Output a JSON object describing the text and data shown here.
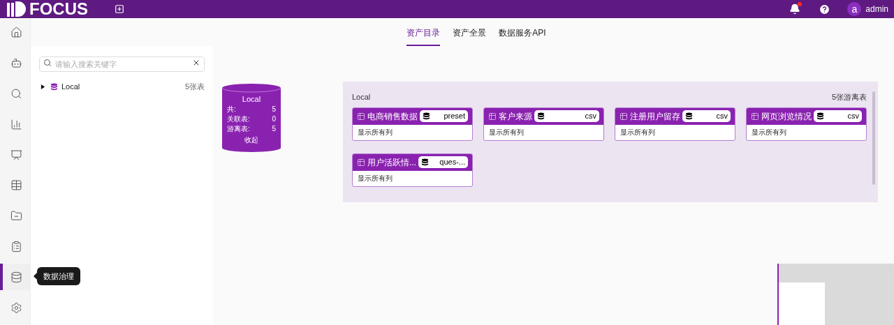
{
  "topbar": {
    "logo": "FOCUS",
    "avatar": "a",
    "user": "admin",
    "notification": true
  },
  "sidebar": {
    "items": [
      {
        "selected": false
      },
      {
        "selected": false
      },
      {
        "selected": false
      },
      {
        "selected": false
      },
      {
        "selected": false
      },
      {
        "selected": false
      },
      {
        "selected": false
      },
      {
        "selected": false
      },
      {
        "selected": true
      },
      {
        "selected": false
      }
    ],
    "tooltip": "数据治理"
  },
  "tabs": [
    {
      "label": "资产目录",
      "selected": true
    },
    {
      "label": "资产全景",
      "selected": false
    },
    {
      "label": "数据服务API",
      "selected": false
    }
  ],
  "search": {
    "placeholder": "请输入搜索关键字"
  },
  "tree": [
    {
      "label": "Local",
      "count": "5张表",
      "expanded": false
    }
  ],
  "source": {
    "title": "Local",
    "stats": [
      {
        "label": "共:",
        "value": "5"
      },
      {
        "label": "关联表:",
        "value": "0"
      },
      {
        "label": "游离表:",
        "value": "5"
      }
    ],
    "toggle": "收起"
  },
  "panel": {
    "title": "Local",
    "count": "5张游离表",
    "tables": [
      {
        "name": "电商销售数据",
        "source": "preset",
        "detail": "显示所有列"
      },
      {
        "name": "客户来源",
        "source": "csv",
        "detail": "显示所有列"
      },
      {
        "name": "注册用户留存",
        "source": "csv",
        "detail": "显示所有列"
      },
      {
        "name": "网页浏览情况",
        "source": "csv",
        "detail": "显示所有列"
      },
      {
        "name": "用户活跃情...",
        "source": "ques-...",
        "detail": "显示所有列"
      }
    ]
  }
}
